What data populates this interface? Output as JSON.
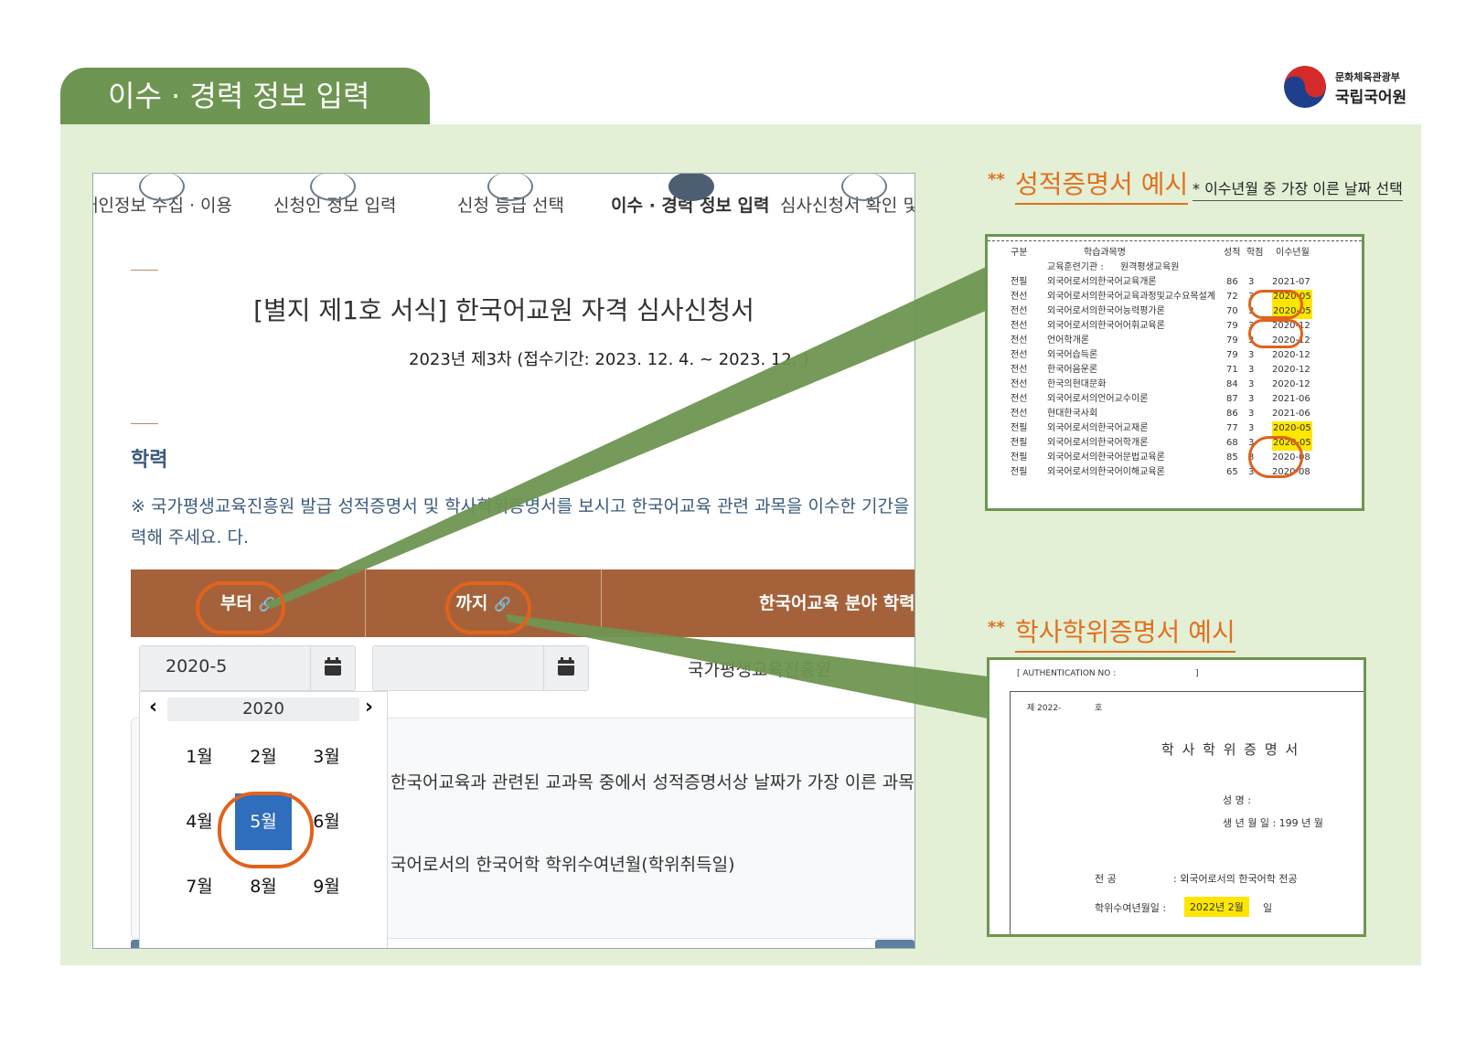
{
  "header": {
    "title": "이수 · 경력 정보 입력"
  },
  "logo": {
    "line1": "문화체육관광부",
    "line2": "국립국어원"
  },
  "steps": [
    "개인정보 수집 · 이용",
    "신청인 정보 입력",
    "신청 등급 선택",
    "이수 · 경력 정보 입력",
    "심사신청서 확인 및"
  ],
  "form": {
    "title": "[별지 제1호 서식] 한국어교원 자격 심사신청서",
    "subtitle": "2023년 제3차 (접수기간: 2023. 12. 4. ~ 2023. 12. )",
    "section_title": "학력",
    "notice": "※ 국가평생교육진흥원 발급 성적증명서 및 학사학위증명서를 보시고 한국어교육 관련 과목을 이수한 기간을 입력해 주세요. 다.",
    "table_headers": [
      "부터",
      "까지",
      "한국어교육 분야 학력"
    ],
    "from_value": "2020-5",
    "to_value": "",
    "row_institution": "국가평생교육진흥원",
    "guide_line1": "한국어교육과 관련된 교과목 중에서 성적증명서상 날짜가 가장 이른 과목",
    "guide_line2": "국어로서의 한국어학 학위수여년월(학위취득일)"
  },
  "picker": {
    "year": "2020",
    "months": [
      "1월",
      "2월",
      "3월",
      "4월",
      "5월",
      "6월",
      "7월",
      "8월",
      "9월"
    ],
    "selected": "5월"
  },
  "transcript_example": {
    "title": "성적증명서 예시",
    "stars": "**",
    "note": "* 이수년월 중 가장 이른 날짜 선택",
    "header": [
      "구분",
      "학습과목명",
      "성적",
      "학점",
      "이수년월"
    ],
    "institution_label": "교육훈련기관 :",
    "institution_name": "원격평생교육원",
    "rows": [
      [
        "전필",
        "외국어로서의한국어교육개론",
        "86",
        "3",
        "2021-07"
      ],
      [
        "전선",
        "외국어로서의한국어교육과정및교수요목설계",
        "72",
        "3",
        "2020-05"
      ],
      [
        "전선",
        "외국어로서의한국어능력평가론",
        "70",
        "3",
        "2020-05"
      ],
      [
        "전선",
        "외국어로서의한국어어휘교육론",
        "79",
        "3",
        "2020-12"
      ],
      [
        "전선",
        "언어학개론",
        "79",
        "3",
        "2020-12"
      ],
      [
        "전선",
        "외국어습득론",
        "79",
        "3",
        "2020-12"
      ],
      [
        "전선",
        "한국어음운론",
        "71",
        "3",
        "2020-12"
      ],
      [
        "전선",
        "한국의현대문화",
        "84",
        "3",
        "2020-12"
      ],
      [
        "전선",
        "외국어로서의언어교수이론",
        "87",
        "3",
        "2021-06"
      ],
      [
        "전선",
        "현대한국사회",
        "86",
        "3",
        "2021-06"
      ],
      [
        "전필",
        "외국어로서의한국어교재론",
        "77",
        "3",
        "2020-05"
      ],
      [
        "전필",
        "외국어로서의한국어학개론",
        "68",
        "3",
        "2020-05"
      ],
      [
        "전필",
        "외국어로서의한국어문법교육론",
        "85",
        "3",
        "2020-08"
      ],
      [
        "전필",
        "외국어로서의한국어이해교육론",
        "65",
        "3",
        "2020-08"
      ]
    ]
  },
  "degree_example": {
    "title": "학사학위증명서 예시",
    "stars": "**",
    "auth": "[ AUTHENTICATION NO :",
    "auth_end": "]",
    "no": "제 2022-",
    "no_suffix": "호",
    "doc_title": "학 사 학 위 증 명 서",
    "name_label": "성      명  :",
    "birth_label": "생 년 월 일  :  199  년   월",
    "major_label": "전     공",
    "major_value": ":  외국어로서의 한국어학 전공",
    "date_label": "학위수여년월일  :",
    "date_value": "2022년 2월",
    "date_suffix": "일"
  },
  "colors": {
    "green": "#6e9551",
    "panel": "#e3f0d6",
    "orange": "#e1621c",
    "brown": "#a5623a",
    "blue": "#2f6ebd"
  }
}
